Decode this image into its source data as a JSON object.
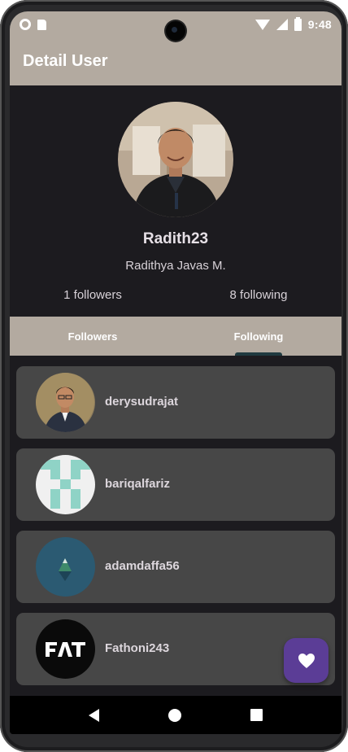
{
  "status_bar": {
    "time": "9:48",
    "icons": [
      "settings-dot-icon",
      "sim-card-icon",
      "wifi-icon",
      "signal-icon",
      "battery-icon"
    ]
  },
  "app_bar": {
    "title": "Detail User"
  },
  "profile": {
    "username": "Radith23",
    "full_name": "Radithya Javas M.",
    "followers": "1 followers",
    "following": "8 following"
  },
  "tabs": [
    {
      "label": "Followers",
      "selected": false
    },
    {
      "label": "Following",
      "selected": true
    }
  ],
  "list": {
    "items": [
      {
        "name": "derysudrajat",
        "avatar": "photo"
      },
      {
        "name": "bariqalfariz",
        "avatar": "identicon"
      },
      {
        "name": "adamdaffa56",
        "avatar": "mountain-logo"
      },
      {
        "name": "Fathoni243",
        "avatar": "fat-logo"
      }
    ]
  },
  "fab": {
    "icon": "heart-icon",
    "color": "#5b3d96"
  },
  "nav_bar": {
    "icons": [
      "back-icon",
      "home-icon",
      "recents-icon"
    ]
  },
  "colors": {
    "primary": "#b3aaa0",
    "background": "#1c1b1f",
    "card": "#474747",
    "accent": "#5b3d96"
  }
}
